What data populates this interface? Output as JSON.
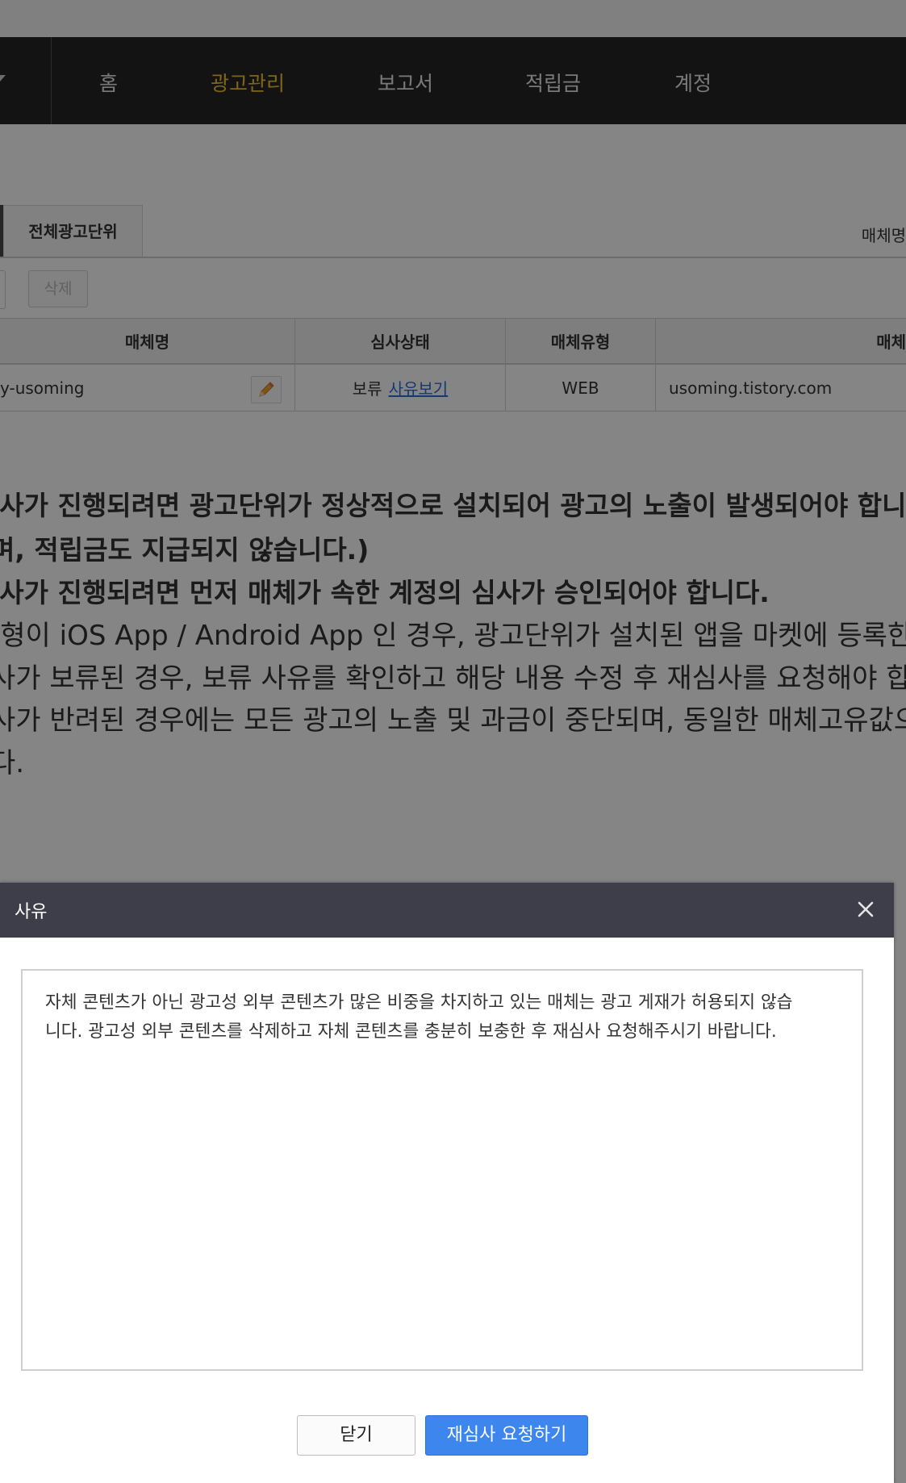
{
  "nav": {
    "items": [
      {
        "label": "홈"
      },
      {
        "label": "광고관리"
      },
      {
        "label": "보고서"
      },
      {
        "label": "적립금"
      },
      {
        "label": "계정"
      }
    ],
    "active_color": "#f2c230"
  },
  "tabs": {
    "active": "전체광고단위",
    "right_label": "매체명"
  },
  "toolbar": {
    "delete_label": "삭제"
  },
  "table": {
    "headers": [
      "매체명",
      "심사상태",
      "매체유형",
      "",
      "매체"
    ],
    "row": {
      "name": "y-usoming",
      "status": "보류",
      "reason_link": "사유보기",
      "type": "WEB",
      "url": "usoming.tistory.com"
    }
  },
  "notices": [
    "l사가 진행되려면 광고단위가 정상적으로 설치되어 광고의 노출이 발생되어야 합니",
    "며, 적립금도 지급되지 않습니다.)",
    "l사가 진행되려면 먼저 매체가 속한 계정의 심사가 승인되어야 합니다.",
    "-형이 iOS App / Android App 인 경우, 광고단위가 설치된 앱을 마켓에 등록한 후",
    "사가 보류된 경우, 보류 사유를 확인하고 해당 내용 수정 후 재심사를 요청해야 합니",
    "사가 반려된 경우에는 모든 광고의 노출 및 과금이 중단되며, 동일한 매체고유값으로",
    "다."
  ],
  "modal": {
    "title": "사유",
    "reason_line1": "자체 콘텐츠가 아닌 광고성 외부 콘텐츠가 많은 비중을 차지하고 있는 매체는 광고 게재가 허용되지 않습",
    "reason_line2": "니다. 광고성 외부 콘텐츠를 삭제하고 자체 콘텐츠를 충분히 보충한 후 재심사 요청해주시기 바랍니다.",
    "close_label": "닫기",
    "rereview_label": "재심사 요청하기",
    "primary_color": "#3c86ee"
  }
}
